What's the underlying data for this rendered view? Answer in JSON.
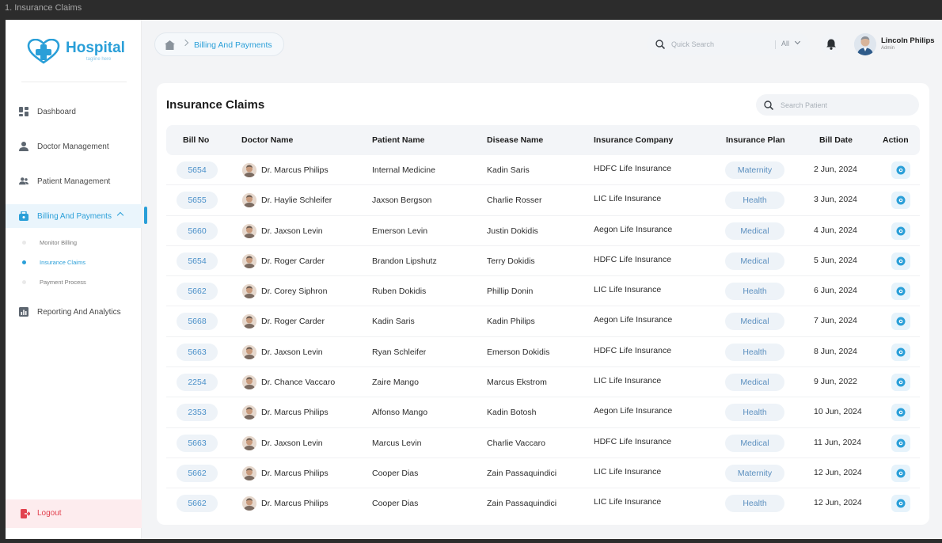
{
  "window": {
    "title": "1. Insurance Claims"
  },
  "brand": {
    "name": "Hospital",
    "tagline": "tagline here"
  },
  "sidebar": {
    "items": [
      {
        "label": "Dashboard",
        "icon": "dashboard-icon"
      },
      {
        "label": "Doctor Management",
        "icon": "doctor-icon"
      },
      {
        "label": "Patient Management",
        "icon": "patients-icon"
      },
      {
        "label": "Billing And Payments",
        "icon": "billing-icon",
        "active": true
      },
      {
        "label": "Reporting And Analytics",
        "icon": "chart-icon"
      }
    ],
    "subitems": [
      {
        "label": "Monitor Billing"
      },
      {
        "label": "Insurance Claims",
        "active": true
      },
      {
        "label": "Payment Process"
      }
    ],
    "logout": "Logout"
  },
  "header": {
    "breadcrumb": "Billing And Payments",
    "search_placeholder": "Quick Search",
    "search_filter": "All",
    "user": {
      "name": "Lincoln Philips",
      "role": "Admin"
    }
  },
  "page": {
    "title": "Insurance Claims",
    "search_placeholder": "Search Patient"
  },
  "table": {
    "columns": [
      "Bill No",
      "Doctor Name",
      "Patient Name",
      "Disease Name",
      "Insurance Company",
      "Insurance Plan",
      "Bill Date",
      "Action"
    ],
    "rows": [
      {
        "bill": "5654",
        "doctor": "Dr. Marcus Philips",
        "patient": "Internal Medicine",
        "disease": "Kadin Saris",
        "company": "HDFC Life Insurance",
        "plan": "Maternity",
        "date": "2 Jun, 2024"
      },
      {
        "bill": "5655",
        "doctor": "Dr. Haylie Schleifer",
        "patient": "Jaxson Bergson",
        "disease": "Charlie Rosser",
        "company": "LIC Life Insurance",
        "plan": "Health",
        "date": "3 Jun, 2024"
      },
      {
        "bill": "5660",
        "doctor": "Dr. Jaxson Levin",
        "patient": "Emerson Levin",
        "disease": "Justin Dokidis",
        "company": "Aegon Life Insurance",
        "plan": "Medical",
        "date": "4 Jun, 2024"
      },
      {
        "bill": "5654",
        "doctor": "Dr. Roger Carder",
        "patient": "Brandon Lipshutz",
        "disease": "Terry Dokidis",
        "company": "HDFC Life Insurance",
        "plan": "Medical",
        "date": "5 Jun, 2024"
      },
      {
        "bill": "5662",
        "doctor": "Dr. Corey Siphron",
        "patient": "Ruben Dokidis",
        "disease": "Phillip Donin",
        "company": "LIC Life Insurance",
        "plan": "Health",
        "date": "6 Jun, 2024"
      },
      {
        "bill": "5668",
        "doctor": "Dr. Roger Carder",
        "patient": "Kadin Saris",
        "disease": "Kadin Philips",
        "company": "Aegon Life Insurance",
        "plan": "Medical",
        "date": "7 Jun, 2024"
      },
      {
        "bill": "5663",
        "doctor": "Dr. Jaxson Levin",
        "patient": "Ryan Schleifer",
        "disease": "Emerson Dokidis",
        "company": "HDFC Life Insurance",
        "plan": "Health",
        "date": "8 Jun, 2024"
      },
      {
        "bill": "2254",
        "doctor": "Dr. Chance Vaccaro",
        "patient": "Zaire Mango",
        "disease": "Marcus Ekstrom",
        "company": "LIC Life Insurance",
        "plan": "Medical",
        "date": "9 Jun, 2022"
      },
      {
        "bill": "2353",
        "doctor": "Dr. Marcus Philips",
        "patient": "Alfonso Mango",
        "disease": "Kadin Botosh",
        "company": "Aegon Life Insurance",
        "plan": "Health",
        "date": "10 Jun, 2024"
      },
      {
        "bill": "5663",
        "doctor": "Dr. Jaxson Levin",
        "patient": "Marcus Levin",
        "disease": "Charlie Vaccaro",
        "company": "HDFC Life Insurance",
        "plan": "Medical",
        "date": "11 Jun, 2024"
      },
      {
        "bill": "5662",
        "doctor": "Dr. Marcus Philips",
        "patient": "Cooper Dias",
        "disease": "Zain Passaquindici",
        "company": "LIC Life Insurance",
        "plan": "Maternity",
        "date": "12 Jun, 2024"
      },
      {
        "bill": "5662",
        "doctor": "Dr. Marcus Philips",
        "patient": "Cooper Dias",
        "disease": "Zain Passaquindici",
        "company": "LIC Life Insurance",
        "plan": "Health",
        "date": "12 Jun, 2024"
      }
    ]
  },
  "colors": {
    "accent": "#2a9fd8",
    "danger": "#e2424f",
    "pill_bg": "#eef3f8"
  }
}
